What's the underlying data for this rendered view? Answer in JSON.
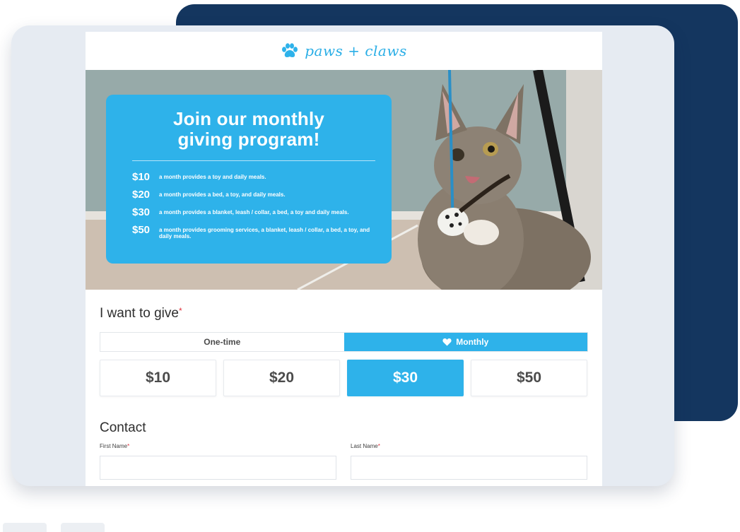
{
  "brand": {
    "logo_text": "paws + claws",
    "logo_icon": "paw-icon",
    "accent": "#2eb2ea",
    "dark_card": "#14365f"
  },
  "hero": {
    "image": "kitten playing with feather toy",
    "promo": {
      "title": "Join our monthly giving program!",
      "tiers": [
        {
          "amount": "$10",
          "description": "a month provides a toy and daily meals."
        },
        {
          "amount": "$20",
          "description": "a month provides a bed, a toy, and daily meals."
        },
        {
          "amount": "$30",
          "description": "a month provides a blanket, leash / collar, a bed, a toy and daily meals."
        },
        {
          "amount": "$50",
          "description": "a month provides grooming services, a blanket, leash / collar, a bed, a toy, and daily meals."
        }
      ]
    }
  },
  "give": {
    "title": "I want to give",
    "required_mark": "*",
    "frequency": [
      {
        "label": "One-time",
        "selected": false
      },
      {
        "label": "Monthly",
        "selected": true,
        "icon": "heart-icon"
      }
    ],
    "amounts": [
      {
        "label": "$10",
        "selected": false
      },
      {
        "label": "$20",
        "selected": false
      },
      {
        "label": "$30",
        "selected": true
      },
      {
        "label": "$50",
        "selected": false
      }
    ]
  },
  "contact": {
    "title": "Contact",
    "fields": [
      {
        "label": "First Name",
        "required_mark": "*",
        "value": ""
      },
      {
        "label": "Last Name",
        "required_mark": "*",
        "value": ""
      }
    ]
  }
}
